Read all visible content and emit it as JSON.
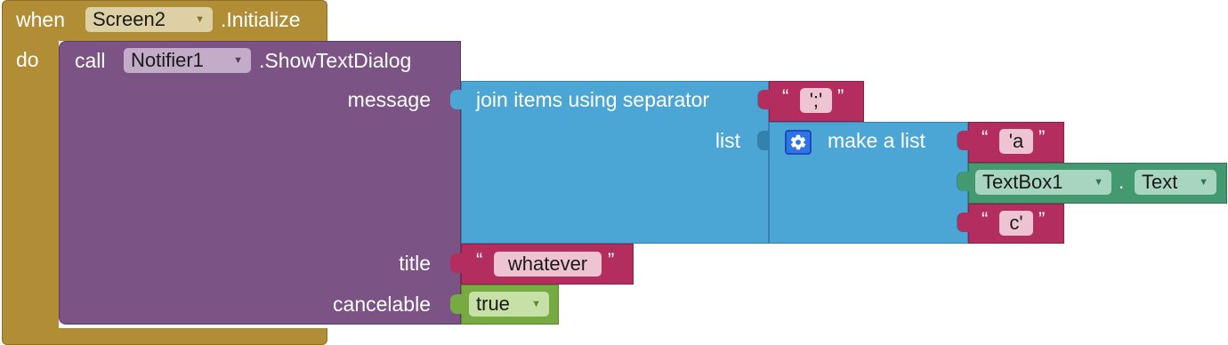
{
  "event_block": {
    "when_label": "when",
    "component": "Screen2",
    "event": ".Initialize",
    "do_label": "do"
  },
  "call_block": {
    "call_label": "call",
    "component": "Notifier1",
    "method": ".ShowTextDialog",
    "params": {
      "message": "message",
      "title": "title",
      "cancelable": "cancelable"
    }
  },
  "join_block": {
    "label": "join items using separator",
    "list_label": "list"
  },
  "separator_text": "';'",
  "make_list_block": {
    "label": "make a list",
    "icon": "gear-icon"
  },
  "list_items": {
    "item1": "'a",
    "item3": "c'"
  },
  "textbox_block": {
    "component": "TextBox1",
    "dot": ".",
    "property": "Text"
  },
  "title_text": "whatever",
  "cancelable_value": "true",
  "dropdown_arrow": "▼",
  "quote_open": "“",
  "quote_close": "”",
  "colors": {
    "event": "#b18e35",
    "procedure": "#7c5385",
    "join": "#4ba6d6",
    "text": "#b32d5e",
    "component": "#439970",
    "logic": "#77ab41"
  }
}
